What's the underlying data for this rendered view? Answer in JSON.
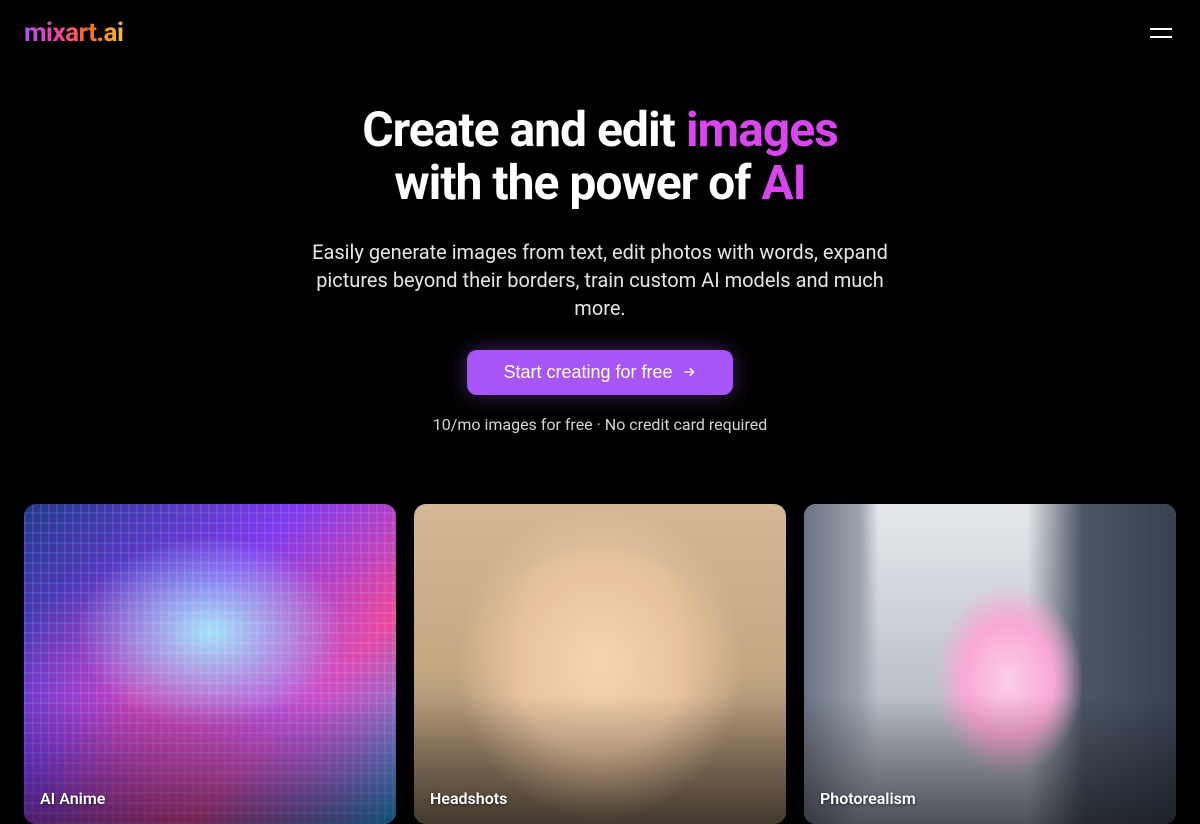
{
  "header": {
    "logo_text": "mixart.ai"
  },
  "hero": {
    "title_part1": "Create and edit ",
    "title_highlight1": "images",
    "title_part2": "with the power of ",
    "title_highlight2": "AI",
    "subtitle": "Easily generate images from text, edit photos with words, expand pictures beyond their borders, train custom AI models and much more.",
    "cta_label": "Start creating for free",
    "cta_note": "10/mo images for free · No credit card required"
  },
  "gallery": {
    "cards": [
      {
        "label": "AI Anime"
      },
      {
        "label": "Headshots"
      },
      {
        "label": "Photorealism"
      }
    ]
  },
  "colors": {
    "accent_pink": "#d946ef",
    "cta_purple": "#a855f7"
  }
}
